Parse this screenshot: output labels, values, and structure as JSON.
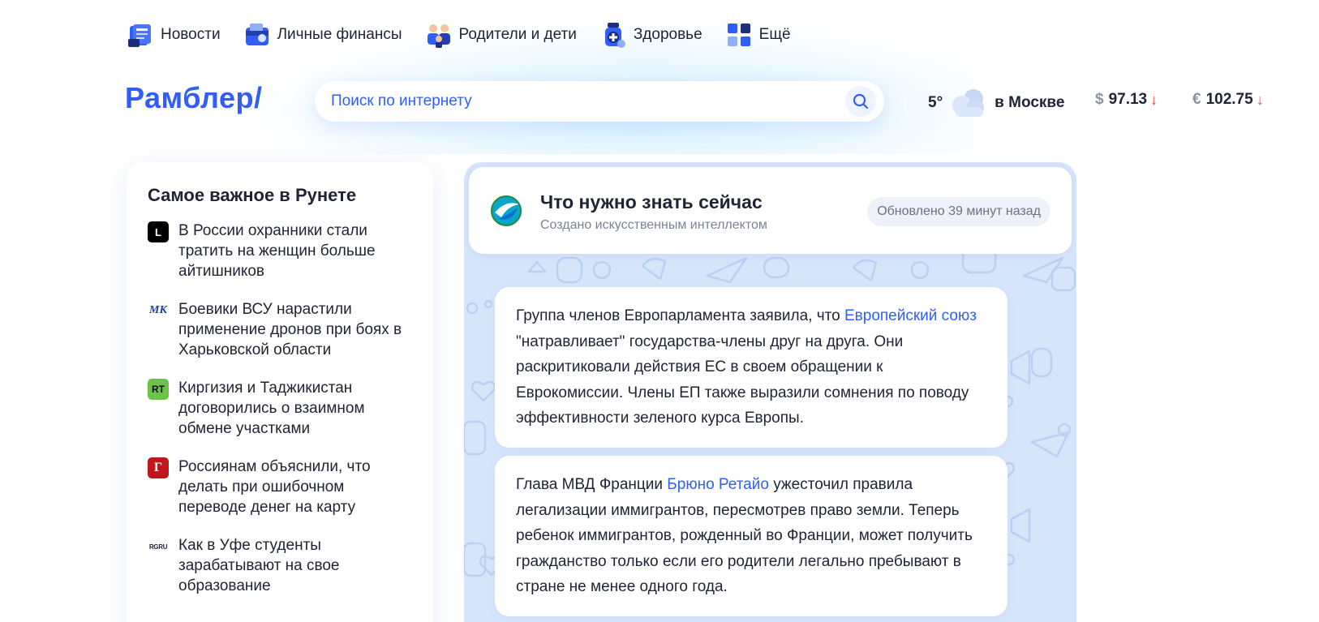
{
  "nav": {
    "items": [
      {
        "label": "Новости",
        "icon": "newspaper-icon"
      },
      {
        "label": "Личные финансы",
        "icon": "wallet-icon"
      },
      {
        "label": "Родители и дети",
        "icon": "family-icon"
      },
      {
        "label": "Здоровье",
        "icon": "medicine-icon"
      },
      {
        "label": "Ещё",
        "icon": "grid-icon"
      }
    ]
  },
  "header": {
    "logo": "Рамблер/",
    "search_placeholder": "Поиск по интернету",
    "weather": {
      "temp": "5°",
      "city": "в Москве",
      "icon": "cloud-icon"
    },
    "rates": [
      {
        "symbol": "$",
        "value": "97.13",
        "trend": "down"
      },
      {
        "symbol": "€",
        "value": "102.75",
        "trend": "down"
      }
    ]
  },
  "top_news": {
    "title": "Самое важное в Рунете",
    "items": [
      {
        "source_label": "L",
        "source_color": "#000000",
        "text": "В России охранники стали тратить на женщин больше айтишников"
      },
      {
        "source_label": "МК",
        "source_color": "#ffffff",
        "text": "Боевики ВСУ нарастили применение дронов при боях в Харьковской области"
      },
      {
        "source_label": "RT",
        "source_color": "#6cc24a",
        "text": "Киргизия и Таджикистан договорились о взаимном обмене участками"
      },
      {
        "source_label": "Г",
        "source_color": "#c0171c",
        "text": "Россиянам объяснили, что делать при ошибочном переводе денег на карту"
      },
      {
        "source_label": "RGRU",
        "source_color": "#ffffff",
        "text": "Как в Уфе студенты зарабатывают на свое образование"
      }
    ]
  },
  "ai_panel": {
    "title": "Что нужно знать сейчас",
    "subtitle": "Создано искусственным интеллектом",
    "updated": "Обновлено 39 минут назад",
    "bubbles": [
      {
        "before": "Группа членов Европарламента заявила, что ",
        "link": "Европейский союз",
        "after": " \"натравливает\" государства-члены друг на друга. Они раскритиковали действия ЕС в своем обращении к Еврокомиссии. Члены ЕП также выразили сомнения по поводу эффективности зеленого курса Европы."
      },
      {
        "before": "Глава МВД Франции ",
        "link": "Брюно Ретайо",
        "after": " ужесточил правила легализации иммигрантов, пересмотрев право земли. Теперь ребенок иммигрантов, рожденный во Франции, может получить гражданство только если его родители легально пребывают в стране не менее одного года."
      }
    ]
  },
  "colors": {
    "accent": "#315efb",
    "down": "#ee3b3b",
    "panel_bg": "#d7e5fb"
  }
}
